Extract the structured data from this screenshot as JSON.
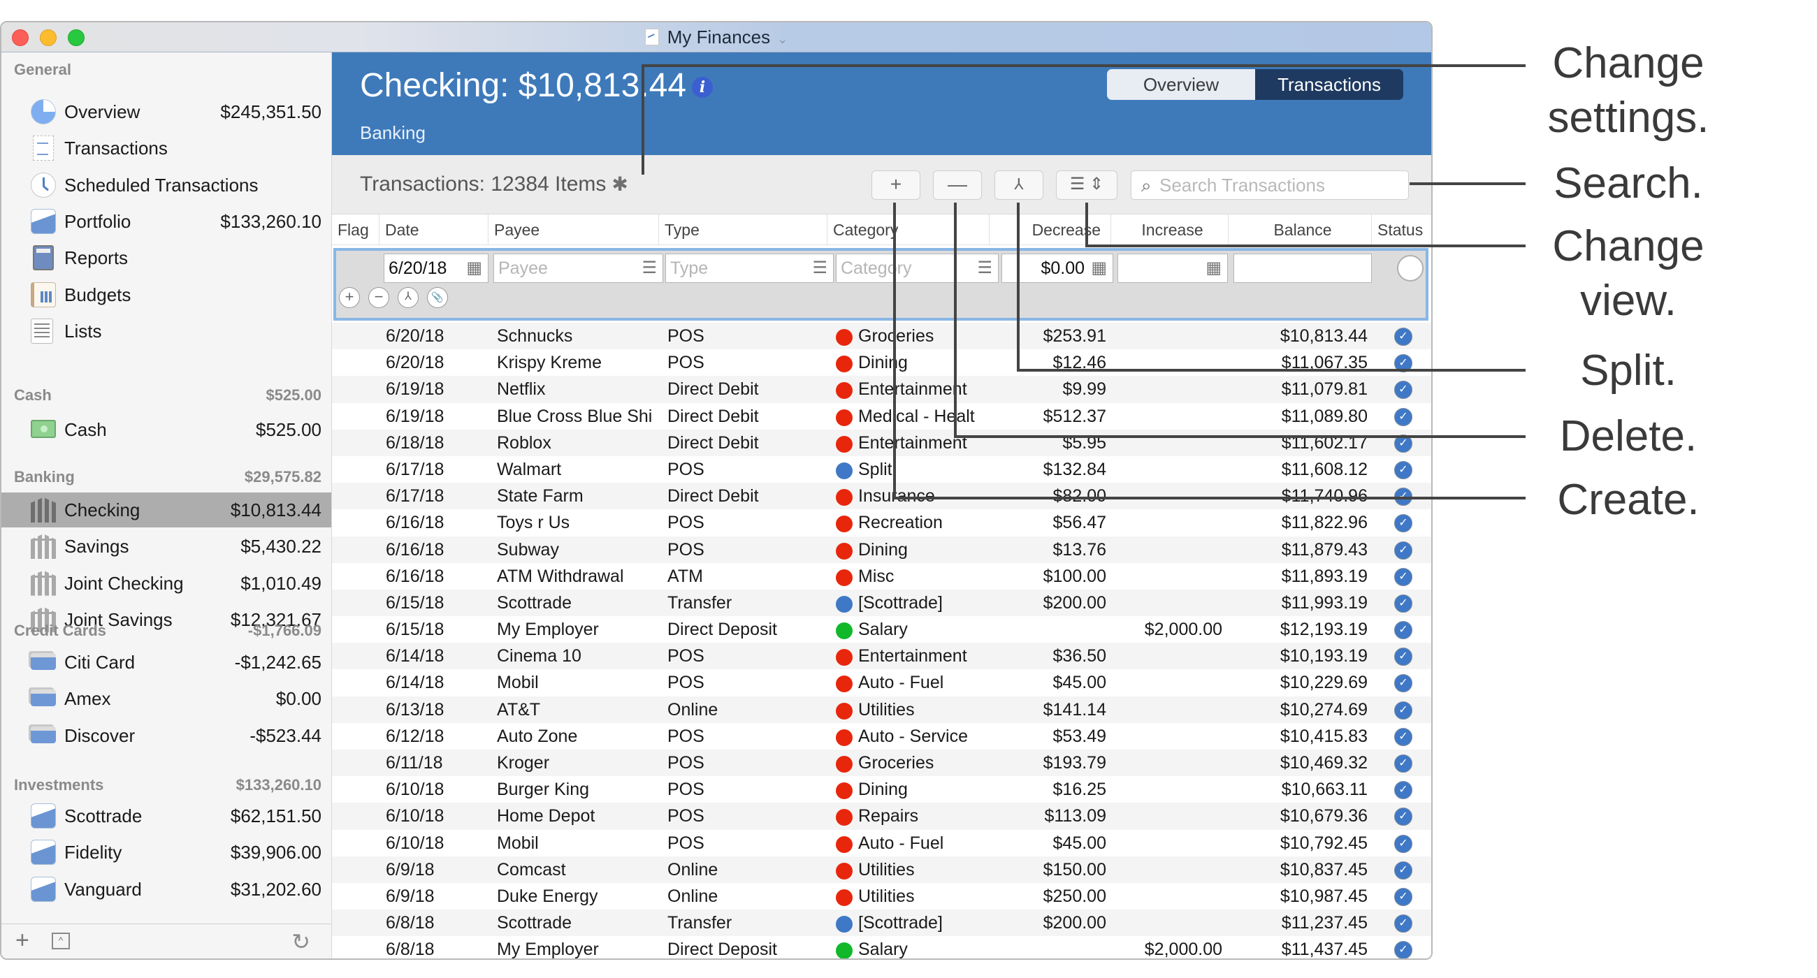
{
  "window": {
    "title": "My Finances",
    "title_icon": "document-chart-icon"
  },
  "sidebar": {
    "sections": [
      {
        "label": "General",
        "total": "",
        "items": [
          {
            "label": "Overview",
            "amount": "$245,351.50",
            "icon": "pie-chart-icon"
          },
          {
            "label": "Transactions",
            "amount": "",
            "icon": "receipt-icon"
          },
          {
            "label": "Scheduled Transactions",
            "amount": "",
            "icon": "clock-icon"
          },
          {
            "label": "Portfolio",
            "amount": "$133,260.10",
            "icon": "line-chart-icon"
          },
          {
            "label": "Reports",
            "amount": "",
            "icon": "calculator-icon"
          },
          {
            "label": "Budgets",
            "amount": "",
            "icon": "budget-icon"
          },
          {
            "label": "Lists",
            "amount": "",
            "icon": "list-icon"
          }
        ]
      },
      {
        "label": "Cash",
        "total": "$525.00",
        "items": [
          {
            "label": "Cash",
            "amount": "$525.00",
            "icon": "cash-icon"
          }
        ]
      },
      {
        "label": "Banking",
        "total": "$29,575.82",
        "items": [
          {
            "label": "Checking",
            "amount": "$10,813.44",
            "icon": "bank-icon",
            "selected": true
          },
          {
            "label": "Savings",
            "amount": "$5,430.22",
            "icon": "bank-icon"
          },
          {
            "label": "Joint Checking",
            "amount": "$1,010.49",
            "icon": "bank-icon"
          },
          {
            "label": "Joint Savings",
            "amount": "$12,321.67",
            "icon": "bank-icon"
          }
        ]
      },
      {
        "label": "Credit Cards",
        "total": "-$1,766.09",
        "items": [
          {
            "label": "Citi Card",
            "amount": "-$1,242.65",
            "icon": "credit-card-icon"
          },
          {
            "label": "Amex",
            "amount": "$0.00",
            "icon": "credit-card-icon"
          },
          {
            "label": "Discover",
            "amount": "-$523.44",
            "icon": "credit-card-icon"
          }
        ]
      },
      {
        "label": "Investments",
        "total": "$133,260.10",
        "items": [
          {
            "label": "Scottrade",
            "amount": "$62,151.50",
            "icon": "line-chart-icon"
          },
          {
            "label": "Fidelity",
            "amount": "$39,906.00",
            "icon": "line-chart-icon"
          },
          {
            "label": "Vanguard",
            "amount": "$31,202.60",
            "icon": "line-chart-icon"
          }
        ]
      }
    ],
    "bottom": {
      "add": "+",
      "collapse": "^",
      "refresh": "↻"
    }
  },
  "header": {
    "account_title": "Checking: $10,813.44",
    "account_type": "Banking",
    "info": "i",
    "tabs": [
      {
        "label": "Overview",
        "active": false
      },
      {
        "label": "Transactions",
        "active": true
      }
    ]
  },
  "toolbar": {
    "count_label": "Transactions: 12384 Items",
    "gear": "✱",
    "add": "+",
    "delete": "—",
    "split": "⅄",
    "view": "☰ ⇕",
    "search_placeholder": "Search Transactions",
    "search_icon": "⌕"
  },
  "columns": [
    "Flag",
    "Date",
    "Payee",
    "Type",
    "Category",
    "Decrease",
    "Increase",
    "Balance",
    "Status"
  ],
  "edit_row": {
    "date": "6/20/18",
    "payee_placeholder": "Payee",
    "type_placeholder": "Type",
    "category_placeholder": "Category",
    "decrease": "$0.00",
    "increase": "",
    "balance": "",
    "buttons": {
      "add": "+",
      "remove": "−",
      "split": "⅄",
      "attach": "📎"
    }
  },
  "colors": {
    "expense": "#e8260c",
    "transfer": "#3f78c6",
    "income": "#10b82a",
    "header_blue": "#3e7aba",
    "selected_tab": "#1f3a61"
  },
  "transactions": [
    {
      "date": "6/20/18",
      "payee": "Schnucks",
      "type": "POS",
      "category": "Groceries",
      "kind": "expense",
      "decrease": "$253.91",
      "increase": "",
      "balance": "$10,813.44",
      "status": "cleared"
    },
    {
      "date": "6/20/18",
      "payee": "Krispy Kreme",
      "type": "POS",
      "category": "Dining",
      "kind": "expense",
      "decrease": "$12.46",
      "increase": "",
      "balance": "$11,067.35",
      "status": "cleared"
    },
    {
      "date": "6/19/18",
      "payee": "Netflix",
      "type": "Direct Debit",
      "category": "Entertainment",
      "kind": "expense",
      "decrease": "$9.99",
      "increase": "",
      "balance": "$11,079.81",
      "status": "cleared"
    },
    {
      "date": "6/19/18",
      "payee": "Blue Cross Blue Shi",
      "type": "Direct Debit",
      "category": "Medical - Healt",
      "kind": "expense",
      "decrease": "$512.37",
      "increase": "",
      "balance": "$11,089.80",
      "status": "cleared"
    },
    {
      "date": "6/18/18",
      "payee": "Roblox",
      "type": "Direct Debit",
      "category": "Entertainment",
      "kind": "expense",
      "decrease": "$5.95",
      "increase": "",
      "balance": "$11,602.17",
      "status": "cleared"
    },
    {
      "date": "6/17/18",
      "payee": "Walmart",
      "type": "POS",
      "category": "Split",
      "kind": "transfer",
      "decrease": "$132.84",
      "increase": "",
      "balance": "$11,608.12",
      "status": "cleared"
    },
    {
      "date": "6/17/18",
      "payee": "State Farm",
      "type": "Direct Debit",
      "category": "Insurance",
      "kind": "expense",
      "decrease": "$82.00",
      "increase": "",
      "balance": "$11,740.96",
      "status": "cleared"
    },
    {
      "date": "6/16/18",
      "payee": "Toys r Us",
      "type": "POS",
      "category": "Recreation",
      "kind": "expense",
      "decrease": "$56.47",
      "increase": "",
      "balance": "$11,822.96",
      "status": "cleared"
    },
    {
      "date": "6/16/18",
      "payee": "Subway",
      "type": "POS",
      "category": "Dining",
      "kind": "expense",
      "decrease": "$13.76",
      "increase": "",
      "balance": "$11,879.43",
      "status": "cleared"
    },
    {
      "date": "6/16/18",
      "payee": "ATM Withdrawal",
      "type": "ATM",
      "category": "Misc",
      "kind": "expense",
      "decrease": "$100.00",
      "increase": "",
      "balance": "$11,893.19",
      "status": "cleared"
    },
    {
      "date": "6/15/18",
      "payee": "Scottrade",
      "type": "Transfer",
      "category": "[Scottrade]",
      "kind": "transfer",
      "decrease": "$200.00",
      "increase": "",
      "balance": "$11,993.19",
      "status": "cleared"
    },
    {
      "date": "6/15/18",
      "payee": "My Employer",
      "type": "Direct Deposit",
      "category": "Salary",
      "kind": "income",
      "decrease": "",
      "increase": "$2,000.00",
      "balance": "$12,193.19",
      "status": "cleared"
    },
    {
      "date": "6/14/18",
      "payee": "Cinema 10",
      "type": "POS",
      "category": "Entertainment",
      "kind": "expense",
      "decrease": "$36.50",
      "increase": "",
      "balance": "$10,193.19",
      "status": "cleared"
    },
    {
      "date": "6/14/18",
      "payee": "Mobil",
      "type": "POS",
      "category": "Auto - Fuel",
      "kind": "expense",
      "decrease": "$45.00",
      "increase": "",
      "balance": "$10,229.69",
      "status": "cleared"
    },
    {
      "date": "6/13/18",
      "payee": "AT&T",
      "type": "Online",
      "category": "Utilities",
      "kind": "expense",
      "decrease": "$141.14",
      "increase": "",
      "balance": "$10,274.69",
      "status": "cleared"
    },
    {
      "date": "6/12/18",
      "payee": "Auto Zone",
      "type": "POS",
      "category": "Auto - Service",
      "kind": "expense",
      "decrease": "$53.49",
      "increase": "",
      "balance": "$10,415.83",
      "status": "cleared"
    },
    {
      "date": "6/11/18",
      "payee": "Kroger",
      "type": "POS",
      "category": "Groceries",
      "kind": "expense",
      "decrease": "$193.79",
      "increase": "",
      "balance": "$10,469.32",
      "status": "cleared"
    },
    {
      "date": "6/10/18",
      "payee": "Burger King",
      "type": "POS",
      "category": "Dining",
      "kind": "expense",
      "decrease": "$16.25",
      "increase": "",
      "balance": "$10,663.11",
      "status": "cleared"
    },
    {
      "date": "6/10/18",
      "payee": "Home Depot",
      "type": "POS",
      "category": "Repairs",
      "kind": "expense",
      "decrease": "$113.09",
      "increase": "",
      "balance": "$10,679.36",
      "status": "cleared"
    },
    {
      "date": "6/10/18",
      "payee": "Mobil",
      "type": "POS",
      "category": "Auto - Fuel",
      "kind": "expense",
      "decrease": "$45.00",
      "increase": "",
      "balance": "$10,792.45",
      "status": "cleared"
    },
    {
      "date": "6/9/18",
      "payee": "Comcast",
      "type": "Online",
      "category": "Utilities",
      "kind": "expense",
      "decrease": "$150.00",
      "increase": "",
      "balance": "$10,837.45",
      "status": "cleared"
    },
    {
      "date": "6/9/18",
      "payee": "Duke Energy",
      "type": "Online",
      "category": "Utilities",
      "kind": "expense",
      "decrease": "$250.00",
      "increase": "",
      "balance": "$10,987.45",
      "status": "cleared"
    },
    {
      "date": "6/8/18",
      "payee": "Scottrade",
      "type": "Transfer",
      "category": "[Scottrade]",
      "kind": "transfer",
      "decrease": "$200.00",
      "increase": "",
      "balance": "$11,237.45",
      "status": "cleared"
    },
    {
      "date": "6/8/18",
      "payee": "My Employer",
      "type": "Direct Deposit",
      "category": "Salary",
      "kind": "income",
      "decrease": "",
      "increase": "$2,000.00",
      "balance": "$11,437.45",
      "status": "cleared"
    }
  ],
  "callouts": [
    {
      "label": "Change settings.",
      "target": "gear"
    },
    {
      "label": "Search.",
      "target": "search"
    },
    {
      "label": "Change view.",
      "target": "view"
    },
    {
      "label": "Split.",
      "target": "split"
    },
    {
      "label": "Delete.",
      "target": "delete"
    },
    {
      "label": "Create.",
      "target": "create"
    }
  ]
}
